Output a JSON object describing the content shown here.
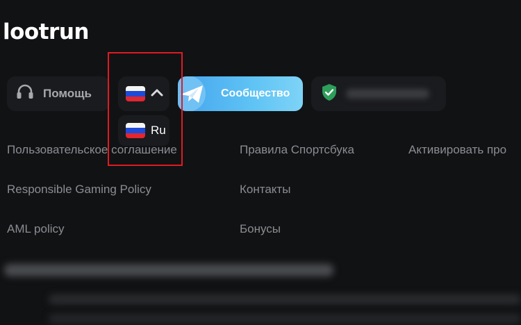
{
  "brand": {
    "logo_text": "lootrun"
  },
  "header": {
    "help_label": "Помощь",
    "language": {
      "current_flag": "russia-flag-icon"
    },
    "community_label": "Сообщество"
  },
  "language_dropdown": {
    "options": [
      {
        "label": "Ru",
        "flag": "russia-flag-icon"
      }
    ]
  },
  "footer_links": {
    "col1": [
      "Пользовательское соглашение",
      "Responsible Gaming Policy",
      "AML policy"
    ],
    "col2": [
      "Правила Спортсбука",
      "Контакты",
      "Бонусы"
    ],
    "col3": [
      "Активировать про"
    ]
  },
  "colors": {
    "background": "#111213",
    "pill": "#1a1b1e",
    "community_gradient_start": "#46a5ee",
    "highlight_border": "#e01b24",
    "shield_green": "#2e9e5b"
  }
}
